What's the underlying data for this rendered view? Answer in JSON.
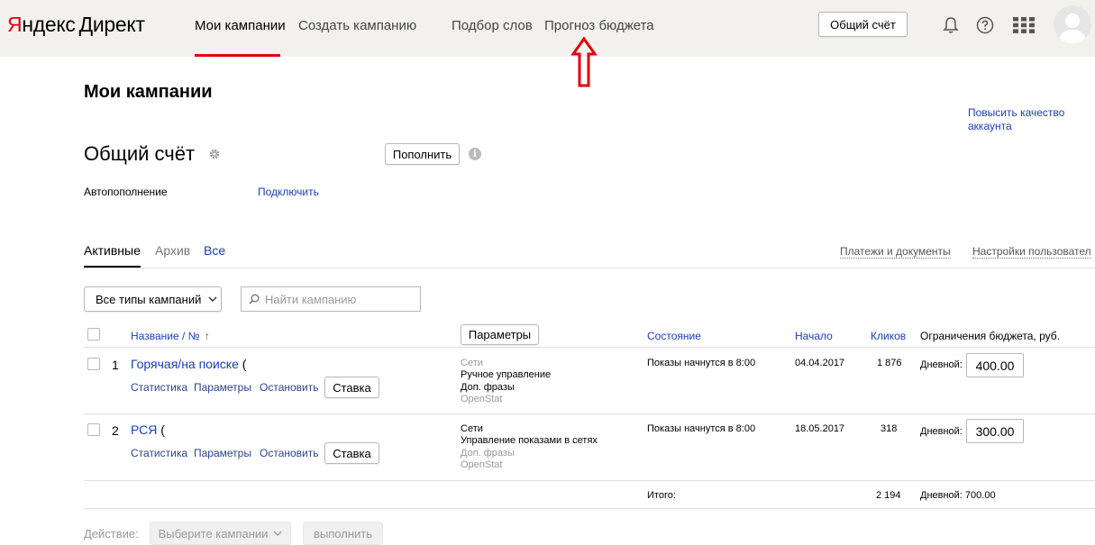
{
  "header": {
    "logo_ya": "Я",
    "logo_ya_rest": "ндекс",
    "logo_direct": "Директ",
    "nav": {
      "my_campaigns": "Мои кампании",
      "create_campaign": "Создать кампанию",
      "keywords": "Подбор слов",
      "budget_forecast": "Прогноз бюджета"
    },
    "shared_account_button": "Общий счёт",
    "icons": [
      "bell-icon",
      "help-icon",
      "apps-grid-icon",
      "avatar"
    ],
    "accent_color": "#e3000f"
  },
  "page": {
    "title": "Мои кампании",
    "improve_quality_link": "Повысить качество аккаунта"
  },
  "account": {
    "title": "Общий счёт",
    "top_up_button": "Пополнить",
    "autopay_label": "Автопополнение",
    "connect_link": "Подключить"
  },
  "tabs": {
    "active": "Активные",
    "archive": "Архив",
    "all": "Все",
    "payments_link": "Платежи и документы",
    "user_settings_link": "Настройки пользовател"
  },
  "filters": {
    "campaign_type_select": "Все типы кампаний",
    "search_placeholder": "Найти кампанию"
  },
  "table": {
    "headers": {
      "name": "Название / №",
      "sort_arrow": "↑",
      "params_button": "Параметры",
      "status": "Состояние",
      "start": "Начало",
      "clicks": "Кликов",
      "budget_limit": "Ограничения бюджета, руб."
    },
    "rows": [
      {
        "num": "1",
        "name": "Горячая/на поиске",
        "name_suffix": "(",
        "actions": [
          "Статистика",
          "Параметры",
          "Остановить"
        ],
        "bid_button": "Ставка",
        "details": [
          "Сети",
          "Ручное управление",
          "Доп. фразы",
          "OpenStat"
        ],
        "status": "Показы начнутся в 8:00",
        "start": "04.04.2017",
        "clicks": "1 876",
        "daily_label": "Дневной:",
        "daily_value": "400.00"
      },
      {
        "num": "2",
        "name": "РСЯ",
        "name_suffix": "(",
        "actions": [
          "Статистика",
          "Параметры",
          "Остановить"
        ],
        "bid_button": "Ставка",
        "details": [
          "Сети",
          "Управление показами в сетях",
          "Доп. фразы",
          "OpenStat"
        ],
        "status": "Показы начнутся в 8:00",
        "start": "18.05.2017",
        "clicks": "318",
        "daily_label": "Дневной:",
        "daily_value": "300.00"
      }
    ],
    "total": {
      "label": "Итого:",
      "clicks": "2 194",
      "daily": "Дневной: 700.00"
    }
  },
  "footer_actions": {
    "action_label": "Действие:",
    "select_campaigns": "Выберите кампании",
    "execute_button": "выполнить"
  }
}
